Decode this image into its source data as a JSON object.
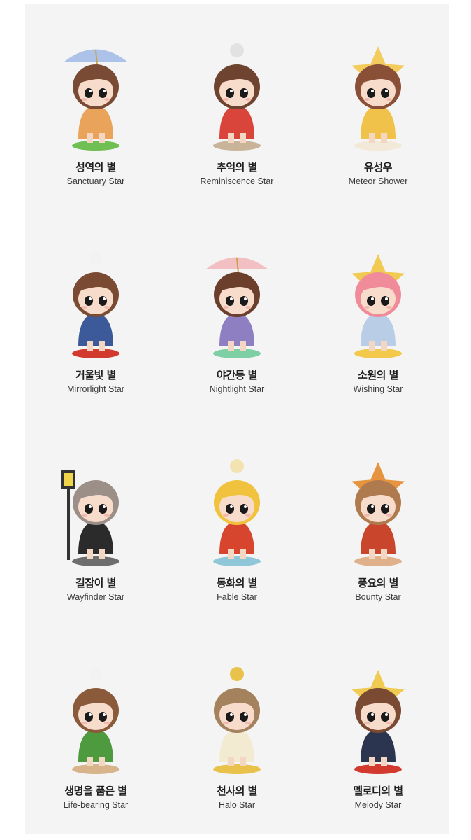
{
  "items": [
    {
      "kr": "성역의 별",
      "en": "Sanctuary Star",
      "hair": "#7a4b34",
      "outfit": "#e9a35a",
      "prop": "#9fb8e6",
      "accent": "#4a8a3a",
      "base": "#6fbf55"
    },
    {
      "kr": "추억의 별",
      "en": "Reminiscence Star",
      "hair": "#6e4430",
      "outfit": "#d9453a",
      "prop": "#a7c7e8",
      "accent": "#e2e2e2",
      "base": "#c9b49a"
    },
    {
      "kr": "유성우",
      "en": "Meteor Shower",
      "hair": "#8a4f37",
      "outfit": "#f0c24a",
      "prop": "#f3c84c",
      "accent": "#e56a2d",
      "base": "#f2e9d8"
    },
    {
      "kr": "거울빛 별",
      "en": "Mirrorlight Star",
      "hair": "#7a4a33",
      "outfit": "#3c5a9a",
      "prop": "#f1d03f",
      "accent": "#f2f2f2",
      "base": "#d23a2f"
    },
    {
      "kr": "야간등 별",
      "en": "Nightlight Star",
      "hair": "#6b3f2c",
      "outfit": "#8d7fc2",
      "prop": "#f1b6b9",
      "accent": "#d8383a",
      "base": "#7fcfa5"
    },
    {
      "kr": "소원의 별",
      "en": "Wishing Star",
      "hair": "#f08b9a",
      "outfit": "#b9cde6",
      "prop": "#f1c53f",
      "accent": "#ef6b4a",
      "base": "#f2c94a"
    },
    {
      "kr": "길잡이 별",
      "en": "Wayfinder Star",
      "hair": "#9b8f88",
      "outfit": "#2b2b2b",
      "prop": "#333333",
      "accent": "#c83a3a",
      "base": "#6d6d6d"
    },
    {
      "kr": "동화의 별",
      "en": "Fable Star",
      "hair": "#f0c23e",
      "outfit": "#d8452f",
      "prop": "#5fae55",
      "accent": "#f2e3b0",
      "base": "#8fc7d8"
    },
    {
      "kr": "풍요의 별",
      "en": "Bounty Star",
      "hair": "#b07a4f",
      "outfit": "#c9452c",
      "prop": "#e68a2e",
      "accent": "#f0e0c0",
      "base": "#e0b08a"
    },
    {
      "kr": "생명을 품은 별",
      "en": "Life-bearing Star",
      "hair": "#8a5a3b",
      "outfit": "#4e9a3e",
      "prop": "#e9d3b0",
      "accent": "#f2f2f2",
      "base": "#d8b48a"
    },
    {
      "kr": "천사의 별",
      "en": "Halo Star",
      "hair": "#a5825e",
      "outfit": "#f3ead2",
      "prop": "#f0f0f0",
      "accent": "#e8c24a",
      "base": "#e8c24a"
    },
    {
      "kr": "멜로디의 별",
      "en": "Melody Star",
      "hair": "#7a4a33",
      "outfit": "#2b3550",
      "prop": "#f1c53f",
      "accent": "#e8a848",
      "base": "#d23a2f"
    }
  ]
}
